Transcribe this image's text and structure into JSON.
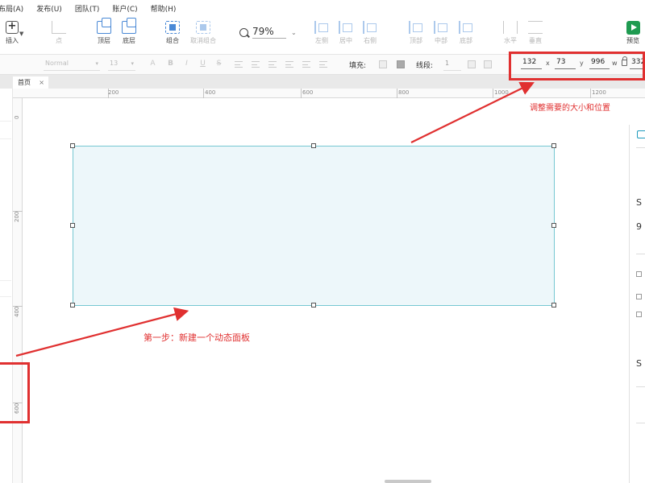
{
  "menu": [
    "布局(A)",
    "发布(U)",
    "团队(T)",
    "账户(C)",
    "帮助(H)"
  ],
  "toolbar": {
    "insert_label": "插入",
    "point_label": "点",
    "top_label": "顶层",
    "bottom_label": "底层",
    "group_label": "组合",
    "ungroup_label": "取消组合",
    "zoom_value": "79%",
    "align_left_label": "左侧",
    "align_center_label": "居中",
    "align_right_label": "右侧",
    "align_top_label": "顶部",
    "align_middle_label": "中部",
    "align_bottom_label": "底部",
    "horizontal_label": "水平",
    "vertical_label": "垂直",
    "preview_label": "预览"
  },
  "formatbar": {
    "font_value": "Normal",
    "size_value": "13",
    "bold": "B",
    "italic": "I",
    "underline": "U",
    "strike": "S",
    "fill_label": "填充:",
    "stroke_label": "线段:",
    "stroke_value": "1"
  },
  "geometry_fields": {
    "x_value": "132",
    "x_label": "x",
    "y_value": "73",
    "y_label": "y",
    "w_value": "996",
    "w_label": "w",
    "h_value": "332"
  },
  "page_tab": {
    "label": "首页",
    "close": "×"
  },
  "ruler": {
    "h_labels": [
      "200",
      "400",
      "600",
      "800",
      "1000",
      "1200"
    ],
    "v_labels": [
      "0",
      "200",
      "400",
      "600"
    ]
  },
  "right_panel_glyphs": [
    "S",
    "9",
    "S"
  ],
  "annotations": {
    "resize_note": "调整需要的大小和位置",
    "step1_note": "第一步：新建一个动态面板",
    "color": "#e03030"
  },
  "colors": {
    "selection_fill": "#edf7fa",
    "selection_border": "#76c8d2",
    "preview_green": "#1f9b51",
    "accent_blue": "#4a89d6"
  }
}
